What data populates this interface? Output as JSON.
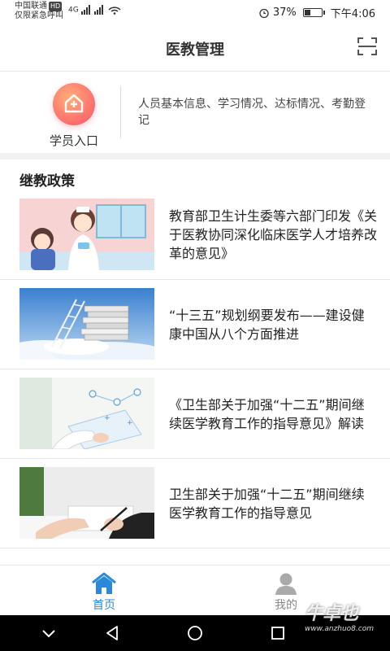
{
  "status_bar": {
    "carrier": "中国联通",
    "hd": "HD",
    "emergency": "仅限紧急呼叫",
    "network": "4G",
    "battery": "37%",
    "battery_level": 0.37,
    "time": "下午4:06"
  },
  "header": {
    "title": "医教管理",
    "scan_icon": "scan-icon"
  },
  "entry": {
    "label": "学员入口",
    "icon": "hospital-icon",
    "description": "人员基本信息、学习情况、达标情况、考勤登记"
  },
  "section": {
    "title": "继教政策"
  },
  "news": [
    {
      "title": "教育部卫生计生委等六部门印发《关于医教协同深化临床医学人才培养改革的意见》",
      "thumb": "nurse-illustration"
    },
    {
      "title": "“十三五”规划纲要发布——建设健康中国从八个方面推进",
      "thumb": "books-ladder-sky"
    },
    {
      "title": "《卫生部关于加强“十二五”期间继续医学教育工作的指导意见》解读",
      "thumb": "medical-tablet"
    },
    {
      "title": "卫生部关于加强“十二五”期间继续医学教育工作的指导意见",
      "thumb": "hand-writing-pen"
    }
  ],
  "tabbar": {
    "home_label": "首页",
    "me_label": "我的",
    "home_icon": "home-icon",
    "me_icon": "user-icon",
    "active_color": "#2a8ad8"
  },
  "watermark": {
    "text": "牛卓也",
    "sub": "www.anzhuo8.com"
  }
}
